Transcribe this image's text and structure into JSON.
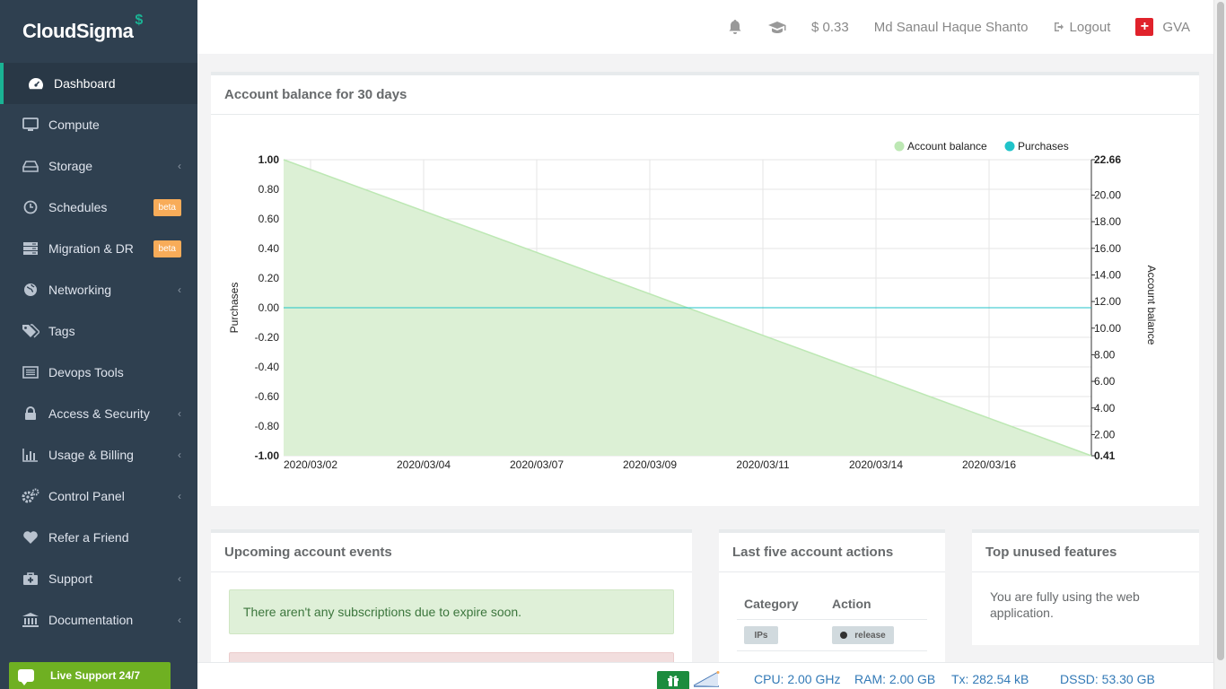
{
  "brand": {
    "name": "CloudSigma",
    "mark": "$"
  },
  "sidebar": {
    "items": [
      {
        "label": "Dashboard",
        "icon": "dashboard-icon",
        "active": true
      },
      {
        "label": "Compute",
        "icon": "monitor-icon"
      },
      {
        "label": "Storage",
        "icon": "hdd-icon",
        "chevron": "‹"
      },
      {
        "label": "Schedules",
        "icon": "clock-icon",
        "badge": "beta"
      },
      {
        "label": "Migration & DR",
        "icon": "server-icon",
        "badge": "beta"
      },
      {
        "label": "Networking",
        "icon": "globe-icon",
        "chevron": "‹"
      },
      {
        "label": "Tags",
        "icon": "tags-icon"
      },
      {
        "label": "Devops Tools",
        "icon": "list-icon"
      },
      {
        "label": "Access & Security",
        "icon": "lock-icon",
        "chevron": "‹"
      },
      {
        "label": "Usage & Billing",
        "icon": "bar-chart-icon",
        "chevron": "‹"
      },
      {
        "label": "Control Panel",
        "icon": "gears-icon",
        "chevron": "‹"
      },
      {
        "label": "Refer a Friend",
        "icon": "heart-icon"
      },
      {
        "label": "Support",
        "icon": "medkit-icon",
        "chevron": "‹"
      },
      {
        "label": "Documentation",
        "icon": "bank-icon",
        "chevron": "‹"
      }
    ],
    "live_support": "Live Support 24/7"
  },
  "topbar": {
    "balance": "$ 0.33",
    "user": "Md Sanaul Haque Shanto",
    "logout": "Logout",
    "location": "GVA"
  },
  "chart_panel": {
    "title": "Account balance for 30 days"
  },
  "chart_data": {
    "type": "area",
    "x": [
      "2020/03/02",
      "2020/03/04",
      "2020/03/07",
      "2020/03/09",
      "2020/03/11",
      "2020/03/14",
      "2020/03/16"
    ],
    "series": [
      {
        "name": "Account balance",
        "axis": "right",
        "color": "#bde8b4",
        "points": [
          [
            "start",
            22.66
          ],
          [
            "end",
            0.41
          ]
        ]
      },
      {
        "name": "Purchases",
        "axis": "left",
        "color": "#20c3c9",
        "points": [
          [
            "start",
            0
          ],
          [
            "end",
            0
          ]
        ]
      }
    ],
    "ylabel_left": "Purchases",
    "ylabel_right": "Account balance",
    "yticks_left": [
      "1.00",
      "0.80",
      "0.60",
      "0.40",
      "0.20",
      "0.00",
      "-0.20",
      "-0.40",
      "-0.60",
      "-0.80",
      "-1.00"
    ],
    "yticks_right": [
      "22.66",
      "20.00",
      "18.00",
      "16.00",
      "14.00",
      "12.00",
      "10.00",
      "8.00",
      "6.00",
      "4.00",
      "2.00",
      "0.41"
    ],
    "ylim_left": [
      -1,
      1
    ],
    "ylim_right": [
      0.41,
      22.66
    ],
    "legend": "top-right",
    "grid": true
  },
  "events_panel": {
    "title": "Upcoming account events",
    "message": "There aren't any subscriptions due to expire soon."
  },
  "actions_panel": {
    "title": "Last five account actions",
    "columns": [
      "Category",
      "Action"
    ],
    "rows": [
      {
        "category": "IPs",
        "action": "release"
      }
    ]
  },
  "unused_panel": {
    "title": "Top unused features",
    "message": "You are fully using the web application."
  },
  "statusbar": {
    "cpu": "CPU: 2.00 GHz",
    "ram": "RAM: 2.00 GB",
    "tx": "Tx: 282.54 kB",
    "dssd": "DSSD: 53.30 GB"
  }
}
